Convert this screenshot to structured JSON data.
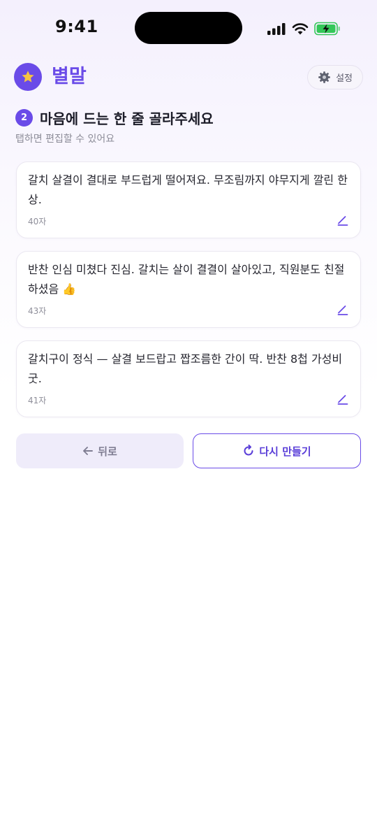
{
  "status_bar": {
    "time": "9:41",
    "icons": [
      "signal-icon",
      "wifi-icon",
      "battery-charging-icon"
    ]
  },
  "header": {
    "logo_icon": "star-icon",
    "app_title": "별말",
    "settings_icon": "gear-icon",
    "settings_label": "설정"
  },
  "step": {
    "number": "2",
    "title": "마음에 드는 한 줄 골라주세요",
    "subtitle": "탭하면 편집할 수 있어요"
  },
  "options": [
    {
      "text": "갈치 살결이 결대로 부드럽게 떨어져요. 무조림까지 야무지게 깔린 한 상.",
      "count": "40자"
    },
    {
      "text": "반찬 인심 미쳤다 진심. 갈치는 살이 결결이 살아있고, 직원분도 친절하셨음 👍",
      "count": "43자"
    },
    {
      "text": "갈치구이 정식 — 살결 보드랍고 짭조름한 간이 딱. 반찬 8첩 가성비 굿.",
      "count": "41자"
    }
  ],
  "buttons": {
    "back_label": "뒤로",
    "back_icon": "arrow-left-icon",
    "regenerate_label": "다시 만들기",
    "regenerate_icon": "refresh-icon"
  },
  "colors": {
    "accent": "#6a4be8",
    "star": "#f6c343",
    "battery": "#34c759"
  }
}
